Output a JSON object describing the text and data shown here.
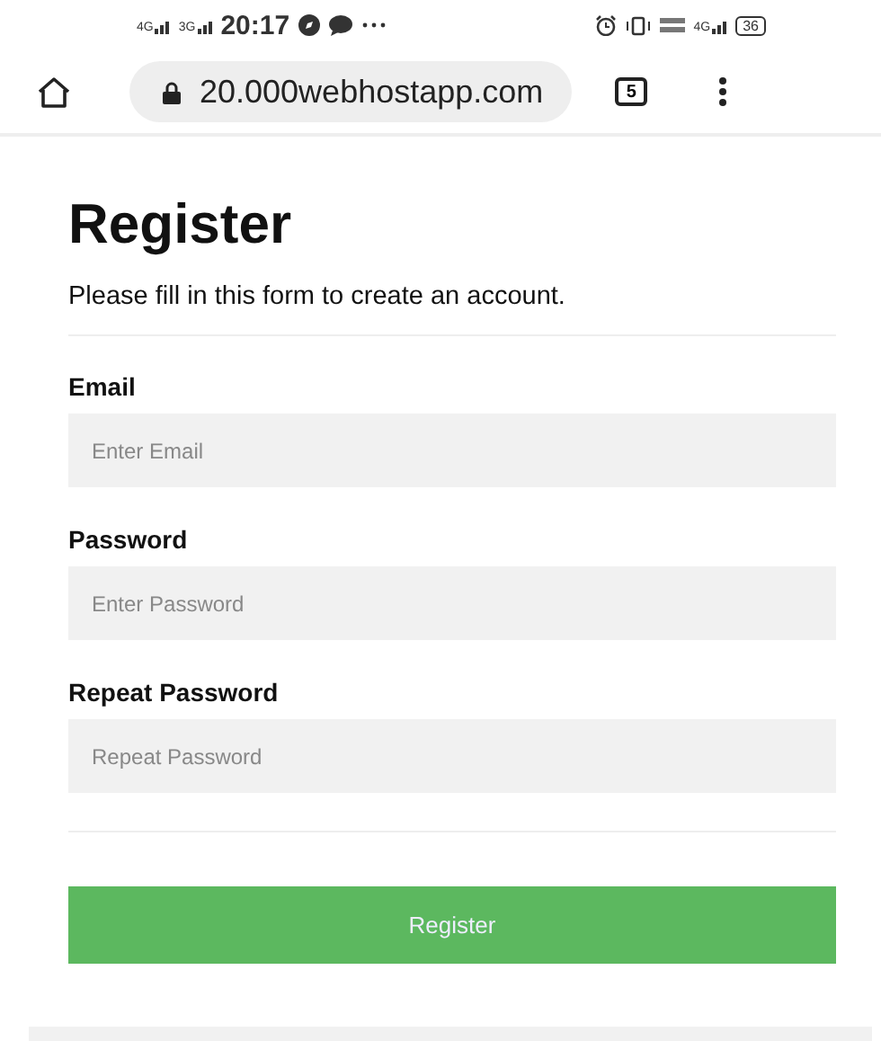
{
  "status_bar": {
    "networks": [
      "4G",
      "3G"
    ],
    "time": "20:17",
    "right_network": "4G",
    "battery": "36"
  },
  "browser": {
    "url": "20.000webhostapp.com",
    "tab_count": "5"
  },
  "form": {
    "title": "Register",
    "subtitle": "Please fill in this form to create an account.",
    "fields": [
      {
        "label": "Email",
        "placeholder": "Enter Email"
      },
      {
        "label": "Password",
        "placeholder": "Enter Password"
      },
      {
        "label": "Repeat Password",
        "placeholder": "Repeat Password"
      }
    ],
    "submit": "Register"
  }
}
